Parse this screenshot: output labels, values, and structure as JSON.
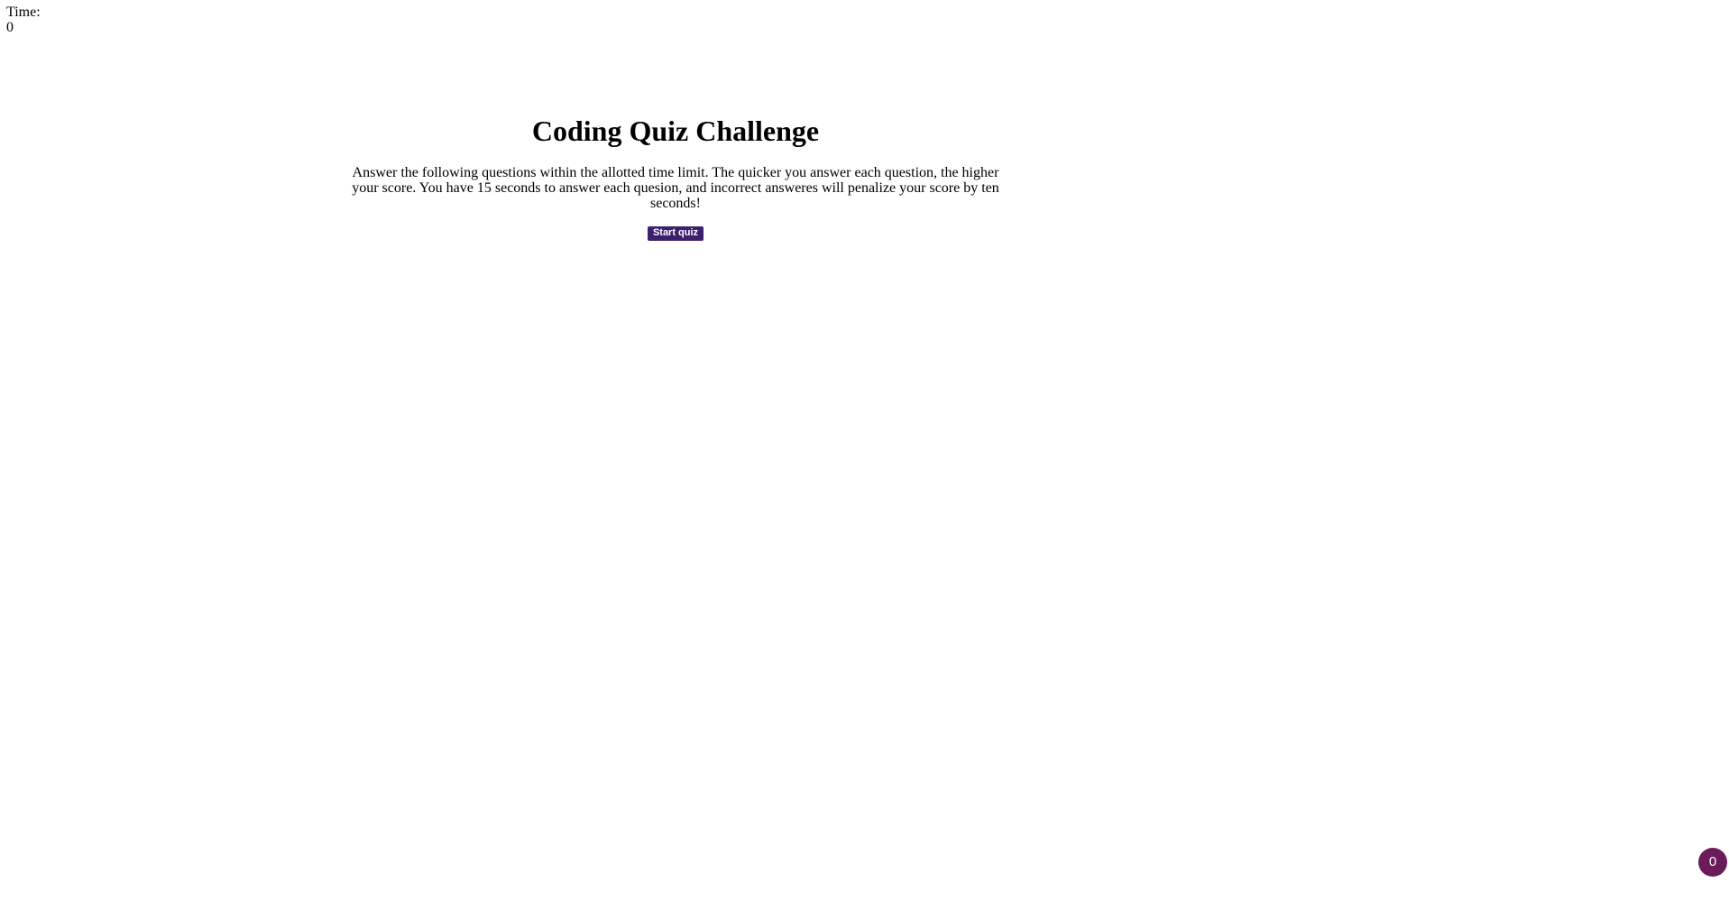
{
  "timer": {
    "label": "Time:",
    "value": "0"
  },
  "quiz": {
    "title": "Coding Quiz Challenge",
    "description": "Answer the following questions within the allotted time limit. The quicker you answer each question, the higher your score. You have 15 seconds to answer each quesion, and incorrect answeres will penalize your score by ten seconds!",
    "start_button_label": "Start quiz"
  },
  "floating_badge": {
    "count": "0"
  },
  "colors": {
    "button_bg": "#3c1f6e",
    "badge_bg": "#6b1a5a",
    "page_bg": "#ffffff"
  }
}
